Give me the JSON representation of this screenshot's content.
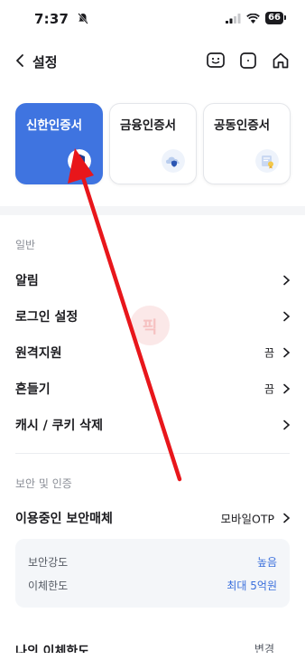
{
  "status_bar": {
    "time": "7:37",
    "battery": "66"
  },
  "header": {
    "title": "설정",
    "icons": [
      "chat-face-icon",
      "square-icon",
      "home-icon"
    ]
  },
  "cert_cards": [
    {
      "label": "신한인증서",
      "icon": "shield-s-icon",
      "active": true
    },
    {
      "label": "금융인증서",
      "icon": "cloud-shield-icon",
      "active": false
    },
    {
      "label": "공동인증서",
      "icon": "certificate-icon",
      "active": false
    }
  ],
  "general": {
    "title": "일반",
    "items": [
      {
        "label": "알림",
        "value": ""
      },
      {
        "label": "로그인 설정",
        "value": ""
      },
      {
        "label": "원격지원",
        "value": "끔"
      },
      {
        "label": "흔들기",
        "value": "끔"
      },
      {
        "label": "캐시 / 쿠키 삭제",
        "value": ""
      }
    ]
  },
  "security": {
    "title": "보안 및 인증",
    "media": {
      "label": "이용중인 보안매체",
      "value": "모바일OTP"
    },
    "details": [
      {
        "key": "보안강도",
        "value": "높음"
      },
      {
        "key": "이체한도",
        "value": "최대 5억원"
      }
    ],
    "partial_row": {
      "label": "나의 이체한도",
      "value": "변경"
    }
  },
  "watermark": {
    "text": "픽"
  },
  "colors": {
    "accent": "#3f74e0",
    "link": "#3a6fdc",
    "arrow": "#e8161b"
  }
}
